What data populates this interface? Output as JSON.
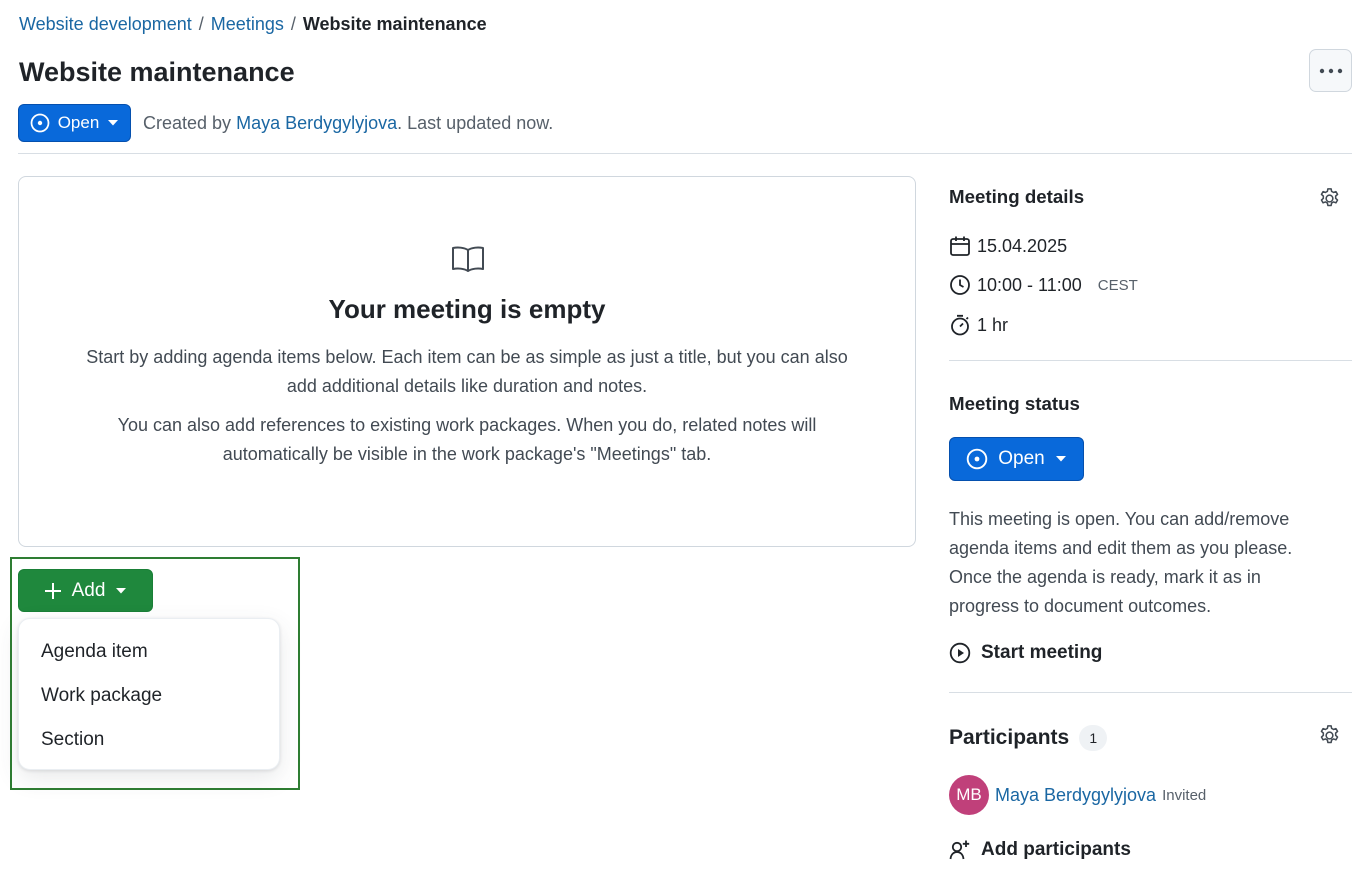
{
  "breadcrumb": {
    "project": "Website development",
    "section": "Meetings",
    "current": "Website maintenance",
    "separator": "/"
  },
  "page": {
    "title": "Website maintenance"
  },
  "status_bar": {
    "status_button_label": "Open",
    "created_by_prefix": "Created by",
    "author": "Maya Berdygylyjova",
    "updated_text": ". Last updated now."
  },
  "empty_state": {
    "icon": "book-icon",
    "heading": "Your meeting is empty",
    "paragraph1": "Start by adding agenda items below. Each item can be as simple as just a title, but you can also add additional details like duration and notes.",
    "paragraph2": "You can also add references to existing work packages. When you do, related notes will automatically be visible in the work package's \"Meetings\" tab."
  },
  "add_menu": {
    "button_label": "Add",
    "items": [
      {
        "label": "Agenda item"
      },
      {
        "label": "Work package"
      },
      {
        "label": "Section"
      }
    ]
  },
  "meeting_details": {
    "heading": "Meeting details",
    "date": "15.04.2025",
    "time": "10:00 - 11:00",
    "timezone": "CEST",
    "duration": "1 hr"
  },
  "meeting_status": {
    "heading": "Meeting status",
    "button_label": "Open",
    "description": "This meeting is open. You can add/remove agenda items and edit them as you please. Once the agenda is ready, mark it as in progress to document outcomes.",
    "start_label": "Start meeting"
  },
  "participants": {
    "heading": "Participants",
    "count": "1",
    "list": [
      {
        "initials": "MB",
        "name": "Maya Berdygylyjova",
        "status": "Invited"
      }
    ],
    "add_label": "Add participants"
  },
  "colors": {
    "primary_blue": "#0969da",
    "add_green": "#1f883d",
    "link": "#1a67a3",
    "avatar": "#c0407a",
    "highlight": "#2e7d32"
  }
}
